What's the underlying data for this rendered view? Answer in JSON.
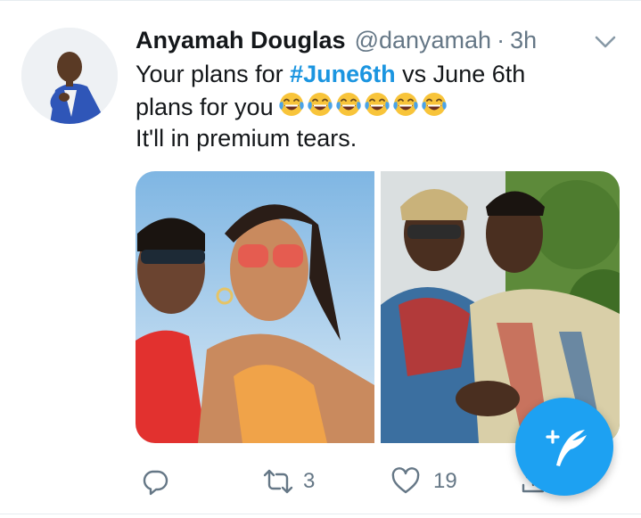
{
  "tweet": {
    "author_name": "Anyamah Douglas",
    "handle": "@danyamah",
    "separator": "·",
    "time": "3h",
    "text": {
      "line1_before": "Your plans for ",
      "hashtag": "#June6th",
      "line1_after": " vs June 6th",
      "line2": "plans for you",
      "line3": "It'll in premium tears."
    },
    "emoji_name": "face-with-tears-of-joy",
    "emoji_count": 6,
    "images": [
      {
        "name": "couple-selfie-sunglasses"
      },
      {
        "name": "couple-photo-outdoors"
      }
    ]
  },
  "actions": {
    "replies": "",
    "retweets": "3",
    "likes": "19"
  },
  "icons": {
    "reply": "reply-icon",
    "retweet": "retweet-icon",
    "like": "heart-icon",
    "share": "share-icon",
    "more": "chevron-down-icon",
    "compose": "compose-tweet-icon"
  },
  "colors": {
    "accent": "#1da1f2",
    "hashtag": "#1b95e0",
    "secondary_text": "#657786",
    "emoji_face": "#f8c43a"
  }
}
